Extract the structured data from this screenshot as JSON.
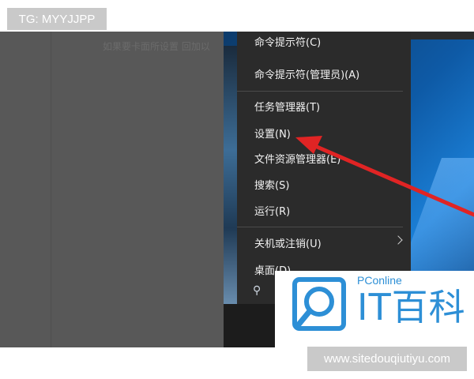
{
  "overlay": {
    "tg_label": "TG: MYYJJPP",
    "site_label": "www.sitedouqiutiyu.com"
  },
  "background": {
    "faded_title": "如果要卡面所设置 回加以"
  },
  "context_menu": {
    "items": [
      {
        "label": "命令提示符(C)"
      },
      {
        "label": "命令提示符(管理员)(A)"
      },
      {
        "label": "任务管理器(T)"
      },
      {
        "label": "设置(N)"
      },
      {
        "label": "文件资源管理器(E)"
      },
      {
        "label": "搜索(S)"
      },
      {
        "label": "运行(R)"
      },
      {
        "label": "关机或注销(U)"
      },
      {
        "label": "桌面(D)"
      }
    ]
  },
  "watermark": {
    "small_text": "PConline",
    "brand_text": "IT百科"
  },
  "colors": {
    "menu_bg": "#2b2b2b",
    "arrow": "#e02424",
    "brand_blue": "#2d8fd6",
    "overlay_gray": "#c9c9c9"
  }
}
